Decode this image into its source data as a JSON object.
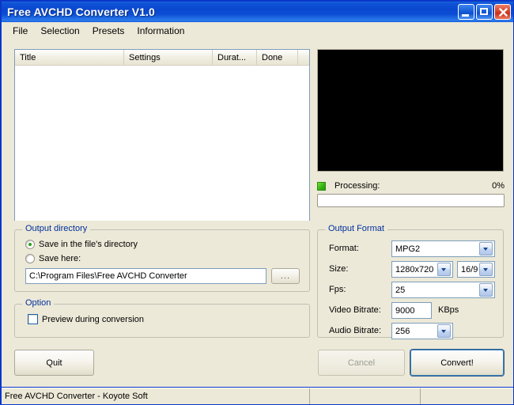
{
  "window": {
    "title": "Free AVCHD Converter V1.0",
    "controls": {
      "minimize": "minimize-button",
      "maximize": "maximize-button",
      "close": "close-button"
    }
  },
  "menubar": {
    "items": [
      {
        "label": "File"
      },
      {
        "label": "Selection"
      },
      {
        "label": "Presets"
      },
      {
        "label": "Information"
      }
    ]
  },
  "filelist": {
    "columns": [
      {
        "label": "Title"
      },
      {
        "label": "Settings"
      },
      {
        "label": "Durat..."
      },
      {
        "label": "Done"
      },
      {
        "label": ""
      }
    ],
    "rows": []
  },
  "preview": {
    "name": "video-preview",
    "background": "#000000"
  },
  "processing": {
    "led_color": "#35B511",
    "label": "Processing:",
    "percent_text": "0%",
    "progress_value": 0
  },
  "output_directory": {
    "group_label": "Output directory",
    "option_file_dir": "Save in the file's directory",
    "option_save_here": "Save here:",
    "selected": "file_dir",
    "path_value": "C:\\Program Files\\Free AVCHD Converter",
    "browse_label": "..."
  },
  "option": {
    "group_label": "Option",
    "preview_label": "Preview during conversion",
    "preview_checked": false
  },
  "output_format": {
    "group_label": "Output Format",
    "format_label": "Format:",
    "format_value": "MPG2",
    "size_label": "Size:",
    "size_value": "1280x720",
    "aspect_value": "16/9",
    "fps_label": "Fps:",
    "fps_value": "25",
    "video_bitrate_label": "Video Bitrate:",
    "video_bitrate_value": "9000",
    "video_bitrate_unit": "KBps",
    "audio_bitrate_label": "Audio Bitrate:",
    "audio_bitrate_value": "256"
  },
  "buttons": {
    "quit": "Quit",
    "cancel": "Cancel",
    "cancel_disabled": true,
    "convert": "Convert!",
    "convert_focused": true
  },
  "statusbar": {
    "panel1": "Free AVCHD Converter - Koyote Soft",
    "panel2": "",
    "panel3": ""
  },
  "colors": {
    "titlebar_blue": "#0A47CF",
    "client_bg": "#ECE9D8",
    "group_label": "#00309C",
    "frame": "#0A36C8"
  }
}
